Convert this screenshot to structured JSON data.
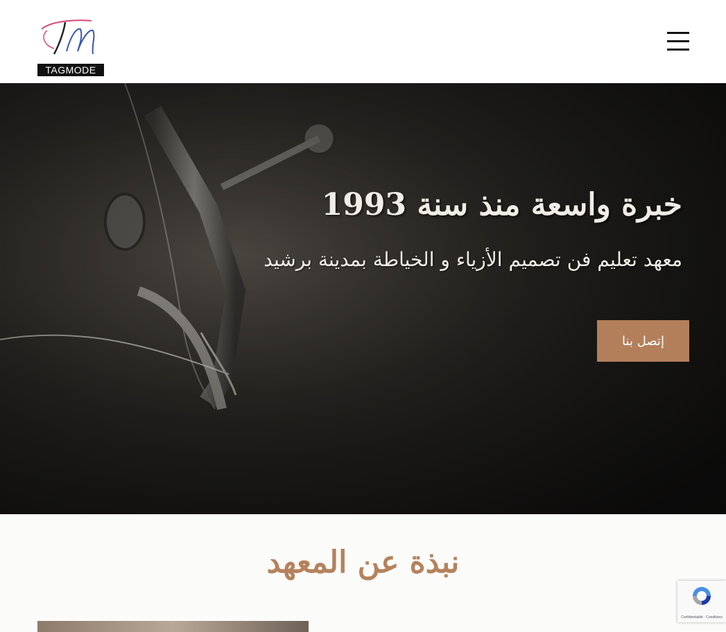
{
  "brand": {
    "logo_wordmark": "TAGMODE",
    "logo_monogram": "TM",
    "accent_color": "#b37f5b"
  },
  "header": {
    "menu_icon": "hamburger-icon"
  },
  "hero": {
    "title": "خبرة واسعة منذ سنة 1993",
    "subtitle": "معهد تعليم فن تصميم الأزياء و الخياطة بمدينة برشيد",
    "cta_label": "إتصل بنا",
    "background": "sewing-machine-photo"
  },
  "about": {
    "title": "نبذة عن المعهد"
  },
  "recaptcha": {
    "icon": "recaptcha-icon",
    "footer_text": "Confidentialité - Conditions"
  }
}
